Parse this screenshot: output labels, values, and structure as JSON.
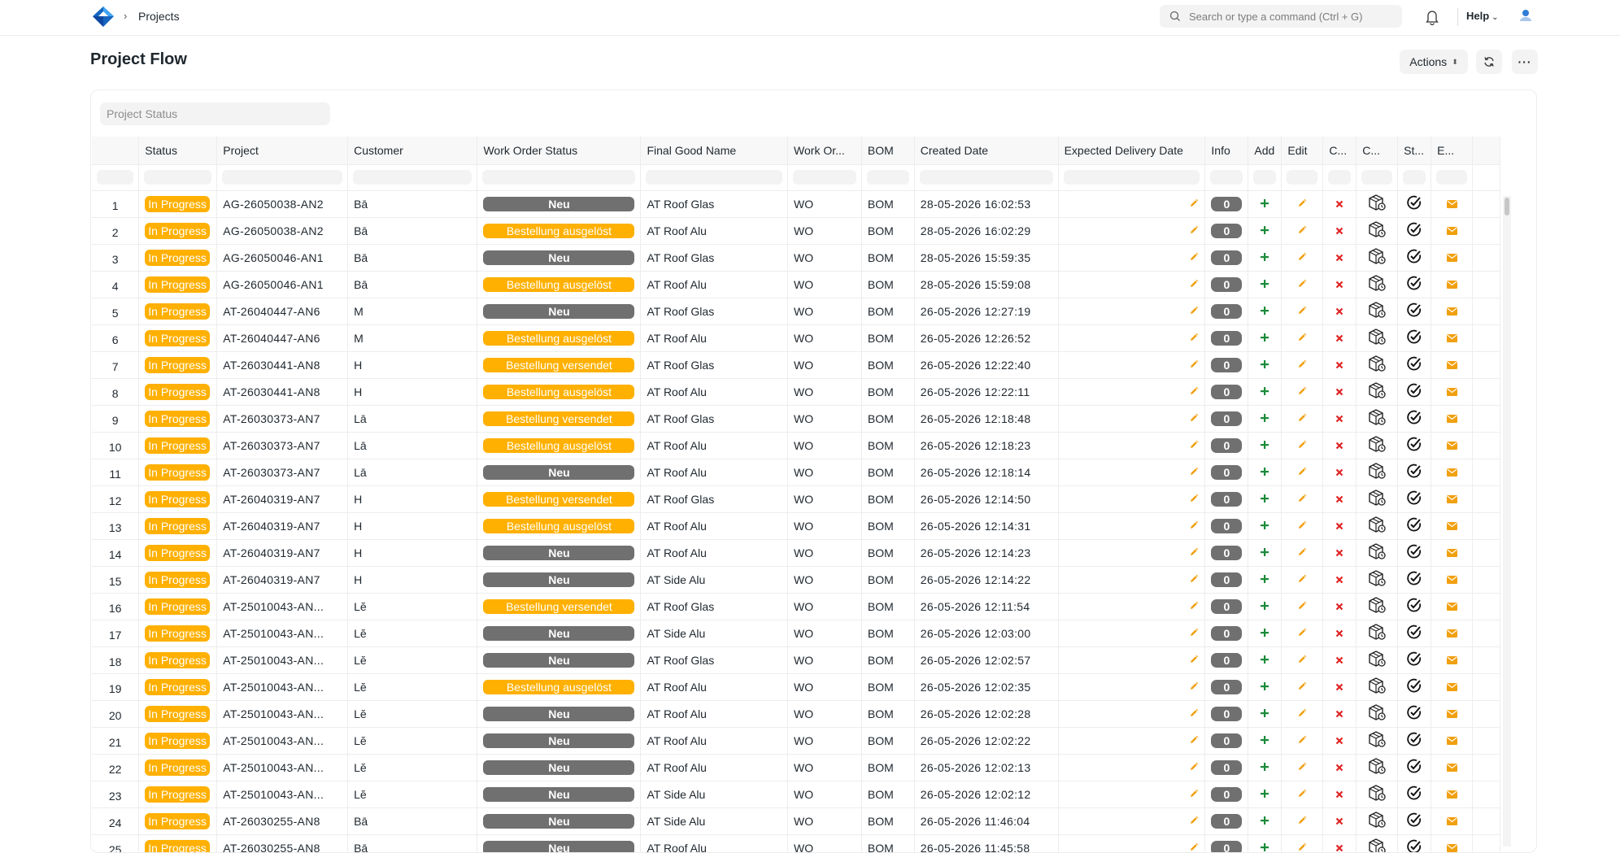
{
  "breadcrumb": {
    "current": "Projects"
  },
  "search": {
    "placeholder": "Search or type a command (Ctrl + G)"
  },
  "help": {
    "label": "Help"
  },
  "page": {
    "title": "Project Flow"
  },
  "actions": {
    "label": "Actions"
  },
  "filters": {
    "project_status_placeholder": "Project Status"
  },
  "table": {
    "columns": [
      "Status",
      "Project",
      "Customer",
      "Work Order Status",
      "Final Good Name",
      "Work Or...",
      "BOM",
      "Created Date",
      "Expected Delivery Date",
      "Info",
      "Add",
      "Edit",
      "C...",
      "C...",
      "St...",
      "E..."
    ],
    "rows": [
      {
        "idx": "1",
        "status": "In Progress",
        "project": "AG-26050038-AN2",
        "customer": "Bā",
        "wo_status": "Neu",
        "final_good": "AT Roof Glas",
        "wo": "WO",
        "bom": "BOM",
        "created": "28-05-2026 16:02:53",
        "info": "0"
      },
      {
        "idx": "2",
        "status": "In Progress",
        "project": "AG-26050038-AN2",
        "customer": "Bā",
        "wo_status": "Bestellung ausgelöst",
        "final_good": "AT Roof Alu",
        "wo": "WO",
        "bom": "BOM",
        "created": "28-05-2026 16:02:29",
        "info": "0"
      },
      {
        "idx": "3",
        "status": "In Progress",
        "project": "AG-26050046-AN1",
        "customer": "Bā",
        "wo_status": "Neu",
        "final_good": "AT Roof Glas",
        "wo": "WO",
        "bom": "BOM",
        "created": "28-05-2026 15:59:35",
        "info": "0"
      },
      {
        "idx": "4",
        "status": "In Progress",
        "project": "AG-26050046-AN1",
        "customer": "Bā",
        "wo_status": "Bestellung ausgelöst",
        "final_good": "AT Roof Alu",
        "wo": "WO",
        "bom": "BOM",
        "created": "28-05-2026 15:59:08",
        "info": "0"
      },
      {
        "idx": "5",
        "status": "In Progress",
        "project": "AT-26040447-AN6",
        "customer": "M",
        "wo_status": "Neu",
        "final_good": "AT Roof Glas",
        "wo": "WO",
        "bom": "BOM",
        "created": "26-05-2026 12:27:19",
        "info": "0"
      },
      {
        "idx": "6",
        "status": "In Progress",
        "project": "AT-26040447-AN6",
        "customer": "M",
        "wo_status": "Bestellung ausgelöst",
        "final_good": "AT Roof Alu",
        "wo": "WO",
        "bom": "BOM",
        "created": "26-05-2026 12:26:52",
        "info": "0"
      },
      {
        "idx": "7",
        "status": "In Progress",
        "project": "AT-26030441-AN8",
        "customer": "H",
        "wo_status": "Bestellung versendet",
        "final_good": "AT Roof Glas",
        "wo": "WO",
        "bom": "BOM",
        "created": "26-05-2026 12:22:40",
        "info": "0"
      },
      {
        "idx": "8",
        "status": "In Progress",
        "project": "AT-26030441-AN8",
        "customer": "H",
        "wo_status": "Bestellung ausgelöst",
        "final_good": "AT Roof Alu",
        "wo": "WO",
        "bom": "BOM",
        "created": "26-05-2026 12:22:11",
        "info": "0"
      },
      {
        "idx": "9",
        "status": "In Progress",
        "project": "AT-26030373-AN7",
        "customer": "Lā",
        "wo_status": "Bestellung versendet",
        "final_good": "AT Roof Glas",
        "wo": "WO",
        "bom": "BOM",
        "created": "26-05-2026 12:18:48",
        "info": "0"
      },
      {
        "idx": "10",
        "status": "In Progress",
        "project": "AT-26030373-AN7",
        "customer": "Lā",
        "wo_status": "Bestellung ausgelöst",
        "final_good": "AT Roof Alu",
        "wo": "WO",
        "bom": "BOM",
        "created": "26-05-2026 12:18:23",
        "info": "0"
      },
      {
        "idx": "11",
        "status": "In Progress",
        "project": "AT-26030373-AN7",
        "customer": "Lā",
        "wo_status": "Neu",
        "final_good": "AT Roof Alu",
        "wo": "WO",
        "bom": "BOM",
        "created": "26-05-2026 12:18:14",
        "info": "0"
      },
      {
        "idx": "12",
        "status": "In Progress",
        "project": "AT-26040319-AN7",
        "customer": "H",
        "wo_status": "Bestellung versendet",
        "final_good": "AT Roof Glas",
        "wo": "WO",
        "bom": "BOM",
        "created": "26-05-2026 12:14:50",
        "info": "0"
      },
      {
        "idx": "13",
        "status": "In Progress",
        "project": "AT-26040319-AN7",
        "customer": "H",
        "wo_status": "Bestellung ausgelöst",
        "final_good": "AT Roof Alu",
        "wo": "WO",
        "bom": "BOM",
        "created": "26-05-2026 12:14:31",
        "info": "0"
      },
      {
        "idx": "14",
        "status": "In Progress",
        "project": "AT-26040319-AN7",
        "customer": "H",
        "wo_status": "Neu",
        "final_good": "AT Roof Alu",
        "wo": "WO",
        "bom": "BOM",
        "created": "26-05-2026 12:14:23",
        "info": "0"
      },
      {
        "idx": "15",
        "status": "In Progress",
        "project": "AT-26040319-AN7",
        "customer": "H",
        "wo_status": "Neu",
        "final_good": "AT Side Alu",
        "wo": "WO",
        "bom": "BOM",
        "created": "26-05-2026 12:14:22",
        "info": "0"
      },
      {
        "idx": "16",
        "status": "In Progress",
        "project": "AT-25010043-AN...",
        "customer": "Lĕ",
        "wo_status": "Bestellung versendet",
        "final_good": "AT Roof Glas",
        "wo": "WO",
        "bom": "BOM",
        "created": "26-05-2026 12:11:54",
        "info": "0"
      },
      {
        "idx": "17",
        "status": "In Progress",
        "project": "AT-25010043-AN...",
        "customer": "Lĕ",
        "wo_status": "Neu",
        "final_good": "AT Side Alu",
        "wo": "WO",
        "bom": "BOM",
        "created": "26-05-2026 12:03:00",
        "info": "0"
      },
      {
        "idx": "18",
        "status": "In Progress",
        "project": "AT-25010043-AN...",
        "customer": "Lĕ",
        "wo_status": "Neu",
        "final_good": "AT Roof Glas",
        "wo": "WO",
        "bom": "BOM",
        "created": "26-05-2026 12:02:57",
        "info": "0"
      },
      {
        "idx": "19",
        "status": "In Progress",
        "project": "AT-25010043-AN...",
        "customer": "Lĕ",
        "wo_status": "Bestellung ausgelöst",
        "final_good": "AT Roof Alu",
        "wo": "WO",
        "bom": "BOM",
        "created": "26-05-2026 12:02:35",
        "info": "0"
      },
      {
        "idx": "20",
        "status": "In Progress",
        "project": "AT-25010043-AN...",
        "customer": "Lĕ",
        "wo_status": "Neu",
        "final_good": "AT Roof Alu",
        "wo": "WO",
        "bom": "BOM",
        "created": "26-05-2026 12:02:28",
        "info": "0"
      },
      {
        "idx": "21",
        "status": "In Progress",
        "project": "AT-25010043-AN...",
        "customer": "Lĕ",
        "wo_status": "Neu",
        "final_good": "AT Roof Alu",
        "wo": "WO",
        "bom": "BOM",
        "created": "26-05-2026 12:02:22",
        "info": "0"
      },
      {
        "idx": "22",
        "status": "In Progress",
        "project": "AT-25010043-AN...",
        "customer": "Lĕ",
        "wo_status": "Neu",
        "final_good": "AT Roof Alu",
        "wo": "WO",
        "bom": "BOM",
        "created": "26-05-2026 12:02:13",
        "info": "0"
      },
      {
        "idx": "23",
        "status": "In Progress",
        "project": "AT-25010043-AN...",
        "customer": "Lĕ",
        "wo_status": "Neu",
        "final_good": "AT Side Alu",
        "wo": "WO",
        "bom": "BOM",
        "created": "26-05-2026 12:02:12",
        "info": "0"
      },
      {
        "idx": "24",
        "status": "In Progress",
        "project": "AT-26030255-AN8",
        "customer": "Bā",
        "wo_status": "Neu",
        "final_good": "AT Side Alu",
        "wo": "WO",
        "bom": "BOM",
        "created": "26-05-2026 11:46:04",
        "info": "0"
      },
      {
        "idx": "25",
        "status": "In Progress",
        "project": "AT-26030255-AN8",
        "customer": "Bā",
        "wo_status": "Neu",
        "final_good": "AT Roof Alu",
        "wo": "WO",
        "bom": "BOM",
        "created": "26-05-2026 11:45:58",
        "info": "0"
      }
    ]
  },
  "colors": {
    "accent": "#ffb000",
    "neutral_pill": "#707070",
    "add_green": "#1b8a3a",
    "delete_red": "#e02424",
    "edit_orange": "#f0a010"
  },
  "icons": {
    "logo": "logo-icon",
    "search": "search-icon",
    "bell": "bell-icon",
    "avatar": "avatar-icon",
    "refresh": "refresh-icon",
    "more": "more-icon",
    "expected_edit": "pencil-icon",
    "add": "plus-icon",
    "edit": "pencil-icon",
    "cancel": "x-icon",
    "close": "box-icon",
    "start": "check-circle-icon",
    "email": "envelope-icon"
  }
}
